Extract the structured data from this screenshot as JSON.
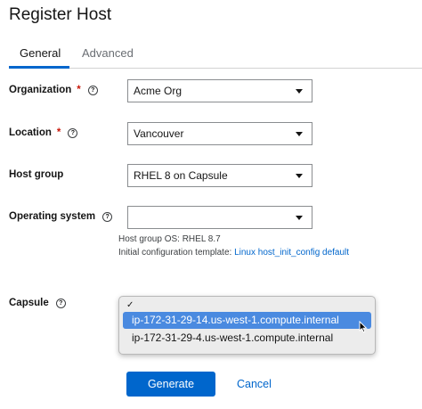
{
  "page": {
    "title": "Register Host"
  },
  "tabs": [
    {
      "label": "General",
      "active": true
    },
    {
      "label": "Advanced",
      "active": false
    }
  ],
  "form": {
    "organization": {
      "label": "Organization",
      "required_marker": "*",
      "value": "Acme Org"
    },
    "location": {
      "label": "Location",
      "required_marker": "*",
      "value": "Vancouver"
    },
    "host_group": {
      "label": "Host group",
      "value": "RHEL 8 on Capsule"
    },
    "operating_system": {
      "label": "Operating system",
      "value": "",
      "hint_os": "Host group OS: RHEL 8.7",
      "hint_template_prefix": "Initial configuration template:",
      "hint_template_link": "Linux host_init_config default"
    },
    "capsule": {
      "label": "Capsule",
      "options": [
        {
          "label": "ip-172-31-29-14.us-west-1.compute.internal",
          "highlighted": true
        },
        {
          "label": "ip-172-31-29-4.us-west-1.compute.internal",
          "highlighted": false
        }
      ],
      "checkmark": "✓"
    }
  },
  "actions": {
    "primary_label": "Generate",
    "cancel_label": "Cancel"
  },
  "colors": {
    "primary": "#0066cc",
    "required": "#c9190b",
    "highlight": "#4a8ae0"
  }
}
